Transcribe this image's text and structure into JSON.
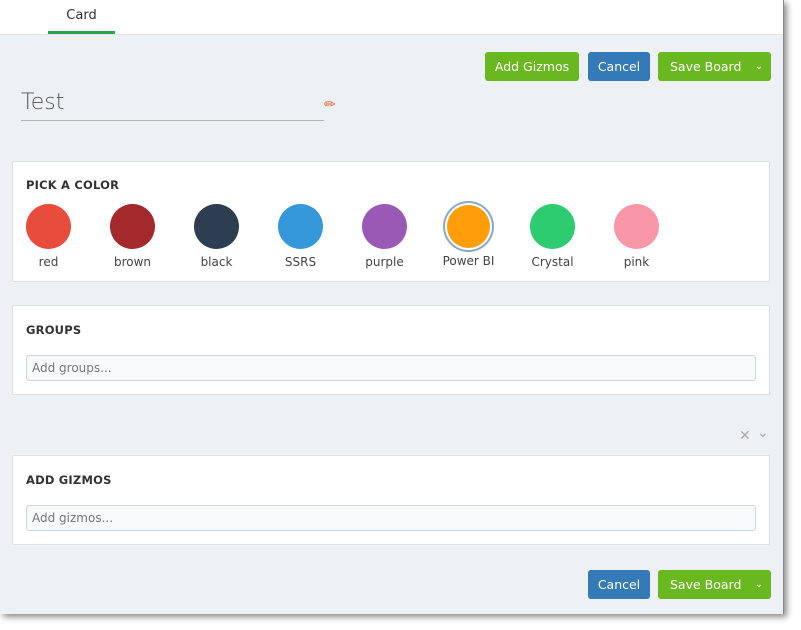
{
  "tabs": [
    {
      "label": "Card",
      "active": true
    }
  ],
  "toolbar": {
    "add_gizmos": "Add Gizmos",
    "cancel": "Cancel",
    "save_board": "Save Board"
  },
  "board_title": "Test",
  "color_section": {
    "heading": "PICK A COLOR",
    "selected": "Power BI",
    "colors": [
      {
        "label": "red",
        "hex": "#e74c3c"
      },
      {
        "label": "brown",
        "hex": "#a3292c"
      },
      {
        "label": "black",
        "hex": "#2c3e50"
      },
      {
        "label": "SSRS",
        "hex": "#3498db"
      },
      {
        "label": "purple",
        "hex": "#9b59b6"
      },
      {
        "label": "Power BI",
        "hex": "#ff9d0a"
      },
      {
        "label": "Crystal",
        "hex": "#2ecc71"
      },
      {
        "label": "pink",
        "hex": "#f797a8"
      }
    ]
  },
  "groups": {
    "heading": "GROUPS",
    "placeholder": "Add groups..."
  },
  "gizmos": {
    "heading": "ADD GIZMOS",
    "placeholder": "Add gizmos..."
  },
  "footer": {
    "cancel": "Cancel",
    "save_board": "Save Board"
  }
}
